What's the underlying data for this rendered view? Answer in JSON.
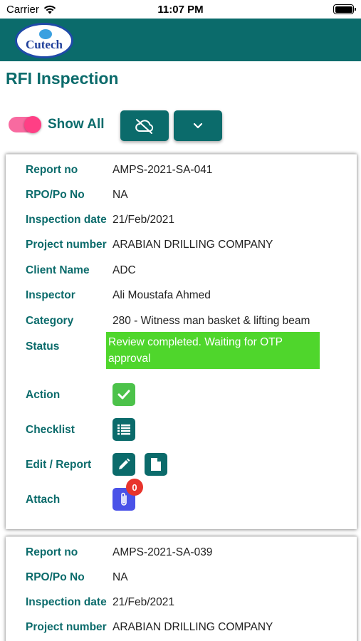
{
  "status_bar": {
    "carrier": "Carrier",
    "time": "11:07 PM"
  },
  "header": {
    "logo_text": "Cutech"
  },
  "page": {
    "title": "RFI Inspection"
  },
  "toolbar": {
    "toggle_label": "Show All",
    "toggle_on": true,
    "cloud_icon": "cloud-off-icon",
    "dropdown_icon": "chevron-down-icon"
  },
  "labels": {
    "report_no": "Report no",
    "rpo": "RPO/Po No",
    "inspection_date": "Inspection date",
    "project_number": "Project number",
    "client_name": "Client Name",
    "inspector": "Inspector",
    "category": "Category",
    "status": "Status",
    "action": "Action",
    "checklist": "Checklist",
    "edit_report": "Edit / Report",
    "attach": "Attach"
  },
  "reports": [
    {
      "report_no": "AMPS-2021-SA-041",
      "rpo": "NA",
      "inspection_date": "21/Feb/2021",
      "project_number": "ARABIAN DRILLING COMPANY",
      "client_name": "ADC",
      "inspector": "Ali Moustafa Ahmed",
      "category": "280 - Witness man basket & lifting beam",
      "status": "Review completed. Waiting for OTP approval",
      "attach_count": "0"
    },
    {
      "report_no": "AMPS-2021-SA-039",
      "rpo": "NA",
      "inspection_date": "21/Feb/2021",
      "project_number": "ARABIAN DRILLING COMPANY"
    }
  ],
  "colors": {
    "primary": "#0b6b6b",
    "status_green": "#4fd62c",
    "toggle_pink": "#ff3f85",
    "attach_blue": "#4a52e8",
    "badge_red": "#e8342c"
  }
}
